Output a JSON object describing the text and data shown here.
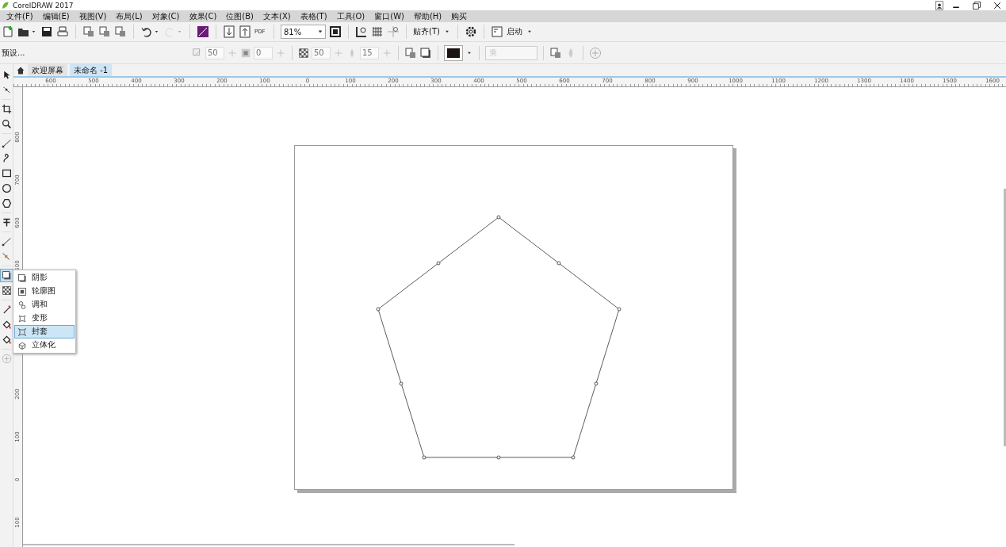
{
  "window": {
    "title": "CorelDRAW 2017"
  },
  "menu": [
    "文件(F)",
    "编辑(E)",
    "视图(V)",
    "布局(L)",
    "对象(C)",
    "效果(C)",
    "位图(B)",
    "文本(X)",
    "表格(T)",
    "工具(O)",
    "窗口(W)",
    "帮助(H)",
    "购买"
  ],
  "toolbar": {
    "pdf_label": "PDF",
    "zoom": "81%",
    "redo_disabled": true,
    "snap_label": "贴齐(T)",
    "launch_label": "启动"
  },
  "property_bar": {
    "preset": "预设...",
    "fields": [
      {
        "value": "50"
      },
      {
        "value": "0"
      },
      {
        "value": "50"
      },
      {
        "value": "15"
      }
    ],
    "merge_mode": {
      "value": "乘",
      "disabled": true
    }
  },
  "tabs": [
    {
      "label": "欢迎屏幕",
      "selected": false
    },
    {
      "label": "未命名 -1",
      "selected": true
    }
  ],
  "ruler_top": {
    "labels": [
      "600",
      "500",
      "400",
      "300",
      "200",
      "100",
      "0",
      "100",
      "200",
      "300",
      "400",
      "500",
      "600",
      "700",
      "800",
      "900",
      "1000",
      "1100",
      "1200",
      "1300",
      "1400",
      "1500",
      "1600"
    ]
  },
  "ruler_left": {
    "labels": [
      "800",
      "700",
      "600",
      "500",
      "200",
      "100",
      "0",
      "100"
    ]
  },
  "toolbox": {
    "flyout": {
      "expanded": true,
      "items": [
        {
          "label": "阴影",
          "selected": false
        },
        {
          "label": "轮廓图",
          "selected": false
        },
        {
          "label": "调和",
          "selected": false
        },
        {
          "label": "变形",
          "selected": false
        },
        {
          "label": "封套",
          "selected": true
        },
        {
          "label": "立体化",
          "selected": false
        }
      ]
    }
  }
}
